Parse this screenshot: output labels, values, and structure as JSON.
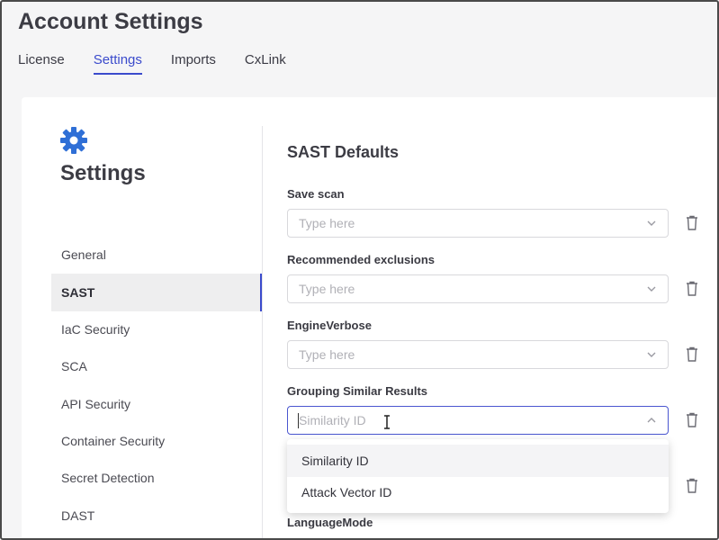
{
  "header": {
    "title": "Account Settings"
  },
  "tabs": [
    {
      "label": "License",
      "active": false
    },
    {
      "label": "Settings",
      "active": true
    },
    {
      "label": "Imports",
      "active": false
    },
    {
      "label": "CxLink",
      "active": false
    }
  ],
  "sidebar": {
    "icon": "gear-icon",
    "title": "Settings",
    "items": [
      {
        "label": "General"
      },
      {
        "label": "SAST",
        "active": true
      },
      {
        "label": "IaC Security"
      },
      {
        "label": "SCA"
      },
      {
        "label": "API Security"
      },
      {
        "label": "Container Security"
      },
      {
        "label": "Secret Detection"
      },
      {
        "label": "DAST"
      }
    ]
  },
  "main": {
    "section_title": "SAST Defaults",
    "fields": [
      {
        "label": "Save scan",
        "placeholder": "Type here"
      },
      {
        "label": "Recommended exclusions",
        "placeholder": "Type here"
      },
      {
        "label": "EngineVerbose",
        "placeholder": "Type here"
      },
      {
        "label": "Grouping Similar Results",
        "placeholder": "Similarity ID",
        "open": true
      },
      {
        "label": "LanguageMode"
      }
    ],
    "dropdown_options": [
      "Similarity ID",
      "Attack Vector ID"
    ]
  },
  "colors": {
    "accent": "#3b4bcc",
    "gear": "#2f6fd6"
  }
}
